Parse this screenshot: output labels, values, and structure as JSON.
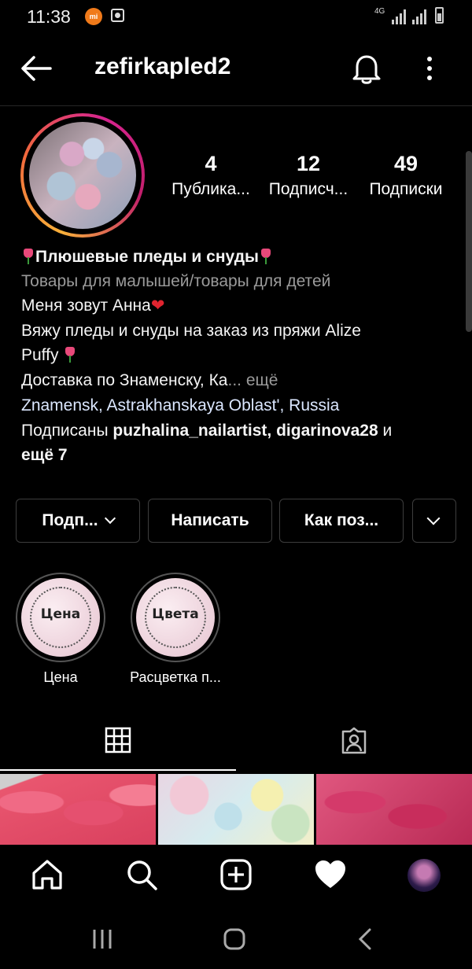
{
  "status_bar": {
    "time": "11:38",
    "mi_label": "mi",
    "network": "4G"
  },
  "header": {
    "username": "zefirkapled2"
  },
  "stats": [
    {
      "value": "4",
      "label": "Публика..."
    },
    {
      "value": "12",
      "label": "Подписч..."
    },
    {
      "value": "49",
      "label": "Подписки"
    }
  ],
  "bio": {
    "name": "Плюшевые пледы и снуды",
    "category": "Товары для малышей/товары для детей",
    "line1": "Меня зовут Анна",
    "heart": "❤",
    "line2": "Вяжу пледы и снуды на заказ из  пряжи Alize",
    "line3": "Puffy",
    "line4": "Доставка по Знаменску, Ка",
    "more": "... ещё",
    "location": "Znamensk, Astrakhanskaya Oblast', Russia",
    "followed_prefix": "Подписаны ",
    "followed_users": "puzhalina_nailartist, digarinova28",
    "followed_and": " и",
    "followed_more": "ещё 7"
  },
  "buttons": {
    "following": "Подп...",
    "message": "Написать",
    "contact": "Как поз..."
  },
  "highlights": [
    {
      "cover_text": "Цена",
      "label": "Цена"
    },
    {
      "cover_text": "Цвета",
      "label": "Расцветка п..."
    }
  ],
  "colors": {
    "background": "#000000",
    "divider": "#262626",
    "button_border": "#3d3d3d",
    "link": "#dbe7ff"
  }
}
